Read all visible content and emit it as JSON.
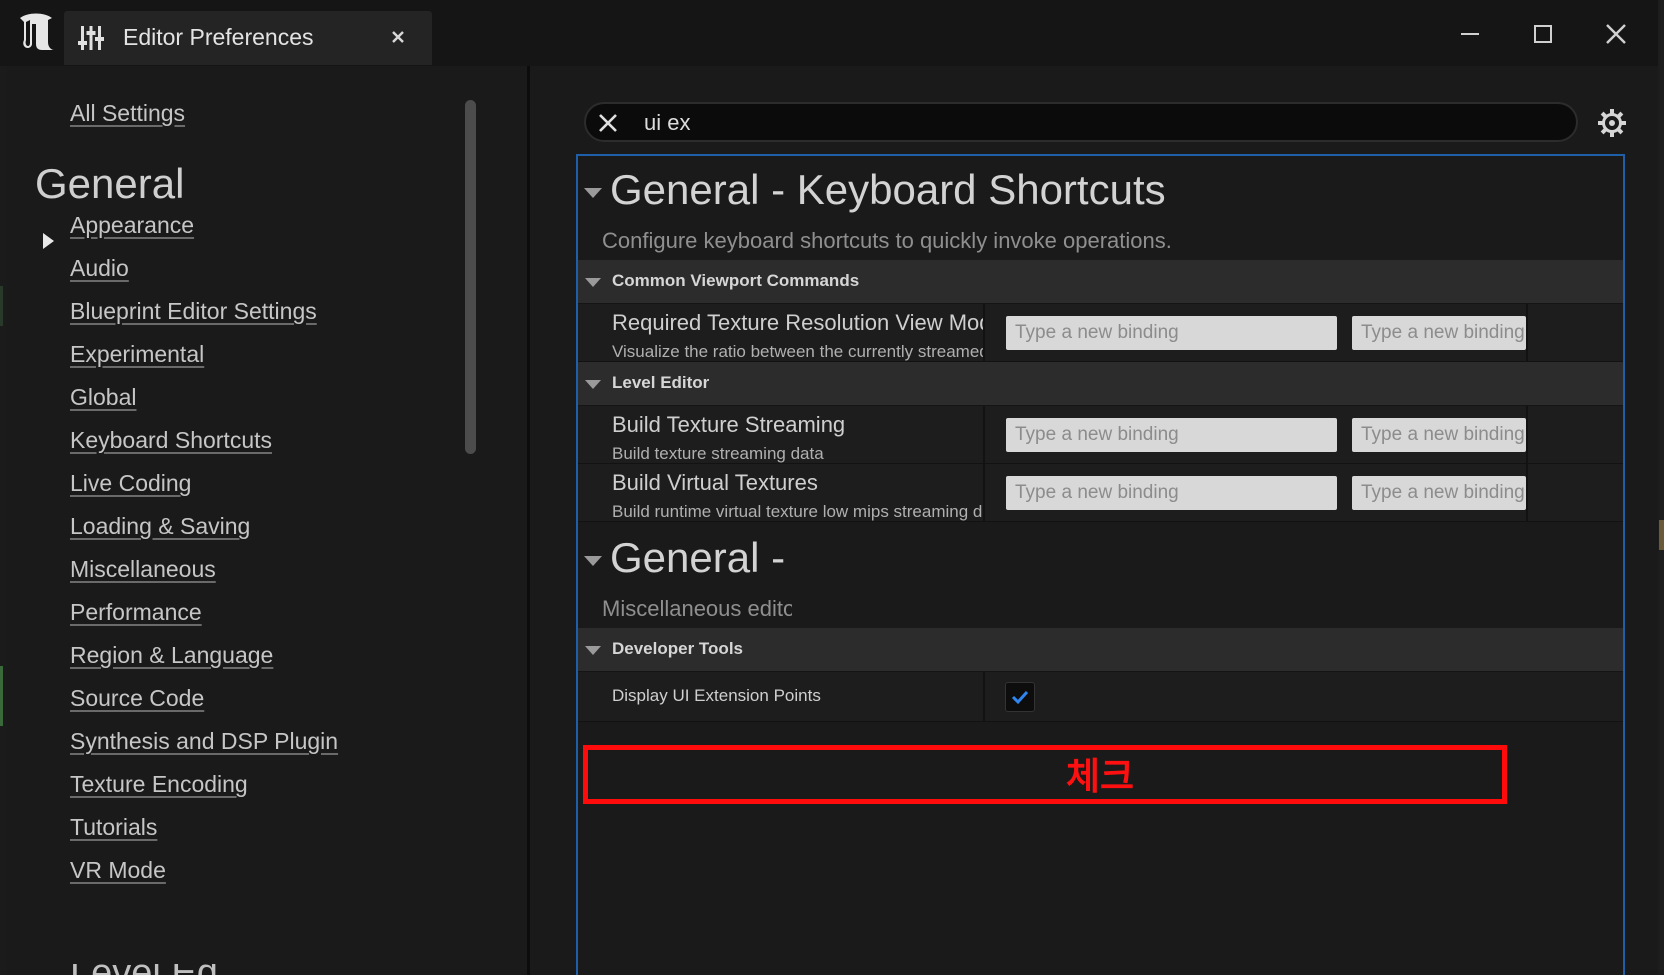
{
  "window": {
    "tab_title": "Editor Preferences"
  },
  "sidebar": {
    "all_settings": "All Settings",
    "heading": "General",
    "items": [
      {
        "label": "Appearance"
      },
      {
        "label": "Audio"
      },
      {
        "label": "Blueprint Editor Settings"
      },
      {
        "label": "Experimental"
      },
      {
        "label": "Global"
      },
      {
        "label": "Keyboard Shortcuts"
      },
      {
        "label": "Live Coding"
      },
      {
        "label": "Loading & Saving"
      },
      {
        "label": "Miscellaneous"
      },
      {
        "label": "Performance"
      },
      {
        "label": "Region & Language"
      },
      {
        "label": "Source Code"
      },
      {
        "label": "Synthesis and DSP Plugin"
      },
      {
        "label": "Texture Encoding"
      },
      {
        "label": "Tutorials"
      },
      {
        "label": "VR Mode"
      }
    ],
    "next_heading_cut": "Level Ed"
  },
  "search": {
    "value": "ui ex"
  },
  "sections": {
    "keyboard": {
      "title": "General - Keyboard Shortcuts",
      "description": "Configure keyboard shortcuts to quickly invoke operations."
    },
    "misc": {
      "title": "General - Miscellaneous",
      "description": "Miscellaneous editor settings."
    }
  },
  "categories": {
    "viewport": "Common Viewport Commands",
    "level_editor": "Level Editor",
    "dev_tools": "Developer Tools"
  },
  "rows": {
    "texres": {
      "name": "Required Texture Resolution View Mode",
      "desc": "Visualize the ratio between the currently streamed resolution"
    },
    "buildstream": {
      "name": "Build Texture Streaming",
      "desc": "Build texture streaming data"
    },
    "buildvt": {
      "name": "Build Virtual Textures",
      "desc": "Build runtime virtual texture low mips streaming data"
    },
    "display_ui": {
      "name": "Display UI Extension Points",
      "checked": true
    }
  },
  "binding_placeholder": "Type a new binding",
  "annotation": {
    "text": "체크",
    "color": "#ff1010"
  },
  "colors": {
    "focus_border": "#1f5fa8",
    "check": "#2f86f0"
  }
}
